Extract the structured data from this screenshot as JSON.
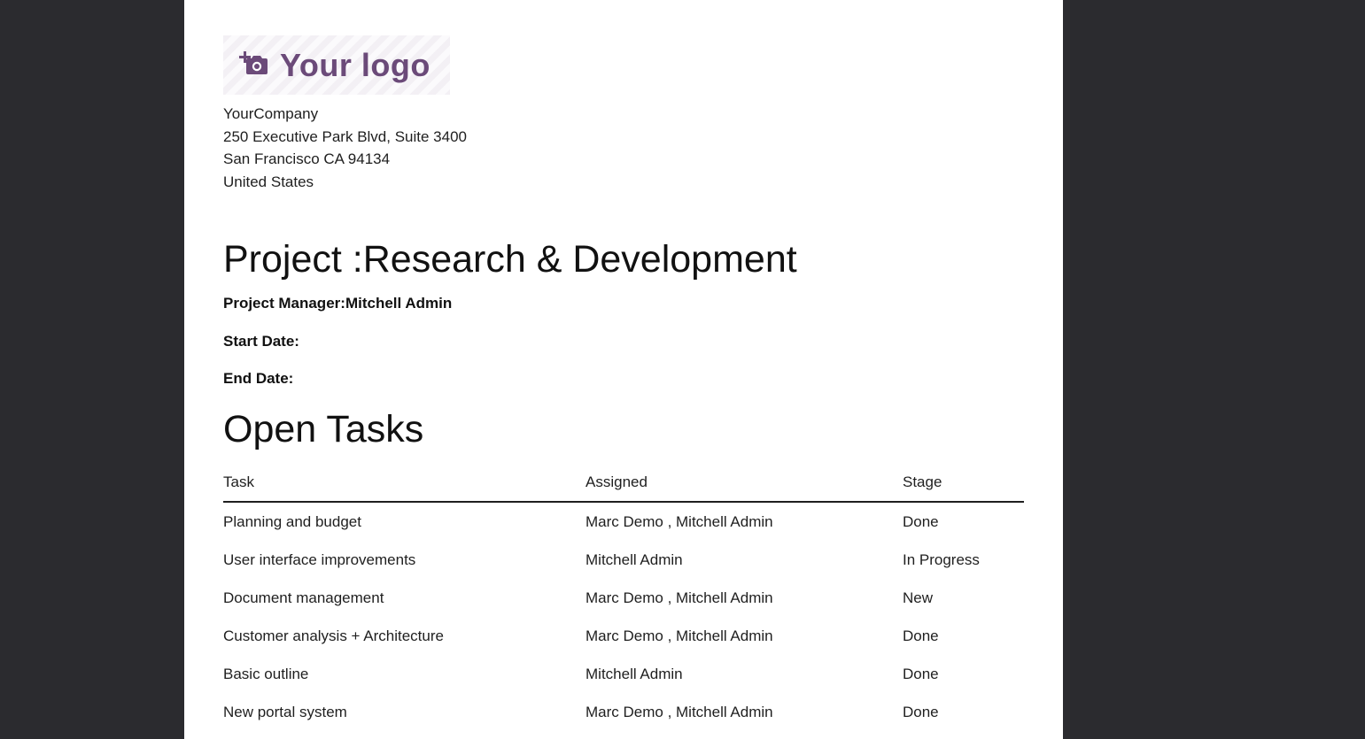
{
  "logo": {
    "icon": "camera-plus-icon",
    "text": "Your logo"
  },
  "company": {
    "name": "YourCompany",
    "street": "250 Executive Park Blvd, Suite 3400",
    "city": "San Francisco CA 94134",
    "country": "United States"
  },
  "project": {
    "title": "Project :Research & Development",
    "manager_label": "Project Manager:",
    "manager_value": "Mitchell Admin",
    "start_label": "Start Date:",
    "end_label": "End Date:"
  },
  "tasks": {
    "section_title": "Open Tasks",
    "columns": [
      "Task",
      "Assigned",
      "Stage"
    ],
    "rows": [
      [
        "Planning and budget",
        "Marc Demo , Mitchell Admin",
        "Done"
      ],
      [
        "User interface improvements",
        "Mitchell Admin",
        "In Progress"
      ],
      [
        "Document management",
        "Marc Demo , Mitchell Admin",
        "New"
      ],
      [
        "Customer analysis + Architecture",
        "Marc Demo , Mitchell Admin",
        "Done"
      ],
      [
        "Basic outline",
        "Mitchell Admin",
        "Done"
      ],
      [
        "New portal system",
        "Marc Demo , Mitchell Admin",
        "Done"
      ]
    ]
  },
  "colors": {
    "background": "#2b2b2f",
    "page": "#ffffff",
    "logo": "#6b4a79",
    "text": "#1f1f1f"
  }
}
